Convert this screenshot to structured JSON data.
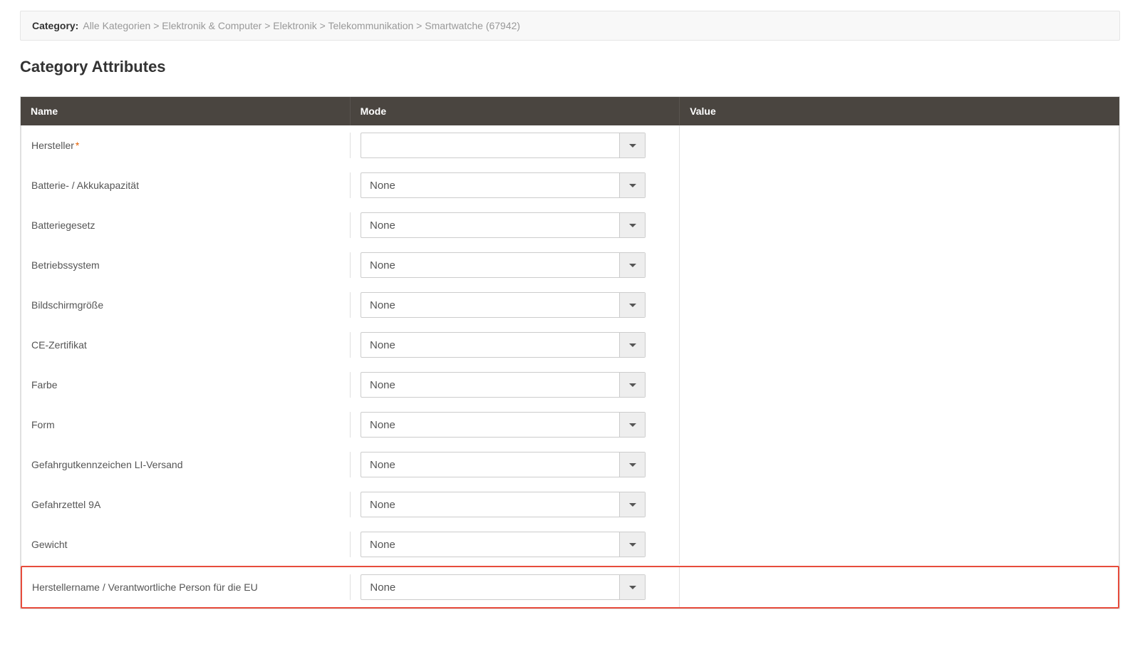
{
  "categoryBar": {
    "label": "Category:",
    "breadcrumb": "Alle Kategorien > Elektronik & Computer > Elektronik > Telekommunikation > Smartwatche (67942)"
  },
  "section": {
    "title": "Category Attributes"
  },
  "table": {
    "headers": {
      "name": "Name",
      "mode": "Mode",
      "value": "Value"
    },
    "rows": [
      {
        "name": "Hersteller",
        "required": true,
        "mode": "",
        "highlighted": false
      },
      {
        "name": "Batterie- / Akkukapazität",
        "required": false,
        "mode": "None",
        "highlighted": false
      },
      {
        "name": "Batteriegesetz",
        "required": false,
        "mode": "None",
        "highlighted": false
      },
      {
        "name": "Betriebssystem",
        "required": false,
        "mode": "None",
        "highlighted": false
      },
      {
        "name": "Bildschirmgröße",
        "required": false,
        "mode": "None",
        "highlighted": false
      },
      {
        "name": "CE-Zertifikat",
        "required": false,
        "mode": "None",
        "highlighted": false
      },
      {
        "name": "Farbe",
        "required": false,
        "mode": "None",
        "highlighted": false
      },
      {
        "name": "Form",
        "required": false,
        "mode": "None",
        "highlighted": false
      },
      {
        "name": "Gefahrgutkennzeichen LI-Versand",
        "required": false,
        "mode": "None",
        "highlighted": false
      },
      {
        "name": "Gefahrzettel 9A",
        "required": false,
        "mode": "None",
        "highlighted": false
      },
      {
        "name": "Gewicht",
        "required": false,
        "mode": "None",
        "highlighted": false
      },
      {
        "name": "Herstellername / Verantwortliche Person für die EU",
        "required": false,
        "mode": "None",
        "highlighted": true
      }
    ],
    "requiredMark": "*"
  }
}
